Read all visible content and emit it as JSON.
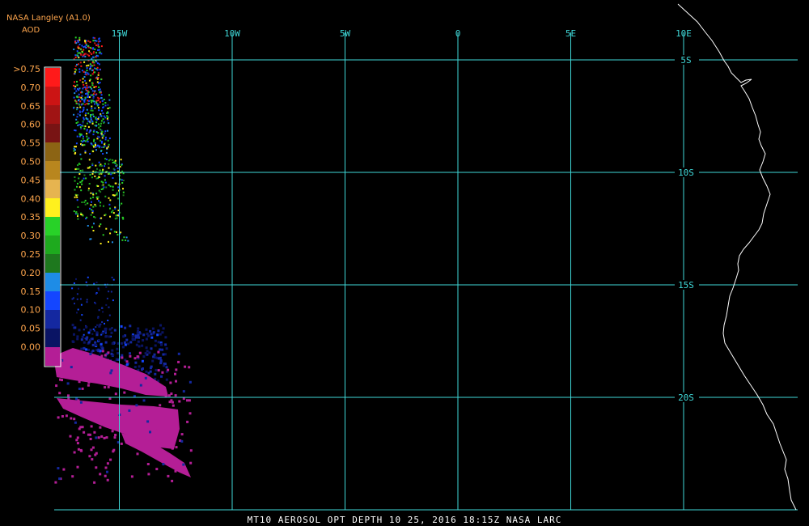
{
  "header": {
    "source": "NASA Langley (A1.0)",
    "product": "AOD"
  },
  "footer": {
    "caption": "MT10  AEROSOL OPT DEPTH   10 25, 2016 18:15Z   NASA LARC"
  },
  "colors": {
    "grid": "#3fd7d7",
    "coast": "#ffffff",
    "legend_text": "#ffa64d",
    "background": "#000000"
  },
  "legend": {
    "labels": [
      ">0.75",
      "0.70",
      "0.65",
      "0.60",
      "0.55",
      "0.50",
      "0.45",
      "0.40",
      "0.35",
      "0.30",
      "0.25",
      "0.20",
      "0.15",
      "0.10",
      "0.05",
      "0.00"
    ],
    "colors": [
      "#ff1a1a",
      "#cc1414",
      "#a01414",
      "#781414",
      "#8c6414",
      "#b8861e",
      "#e6b450",
      "#fff01e",
      "#28d228",
      "#1eaa1e",
      "#1e781e",
      "#1e8ce6",
      "#1446ff",
      "#1428a0",
      "#0a1464",
      "#b41e96"
    ]
  },
  "grid": {
    "longitudes": [
      {
        "label": "15W",
        "lon": -15
      },
      {
        "label": "10W",
        "lon": -10
      },
      {
        "label": "5W",
        "lon": -5
      },
      {
        "label": "0",
        "lon": 0
      },
      {
        "label": "5E",
        "lon": 5
      },
      {
        "label": "10E",
        "lon": 10
      }
    ],
    "latitudes": [
      {
        "label": "5S",
        "lat": -5
      },
      {
        "label": "10S",
        "lat": -10
      },
      {
        "label": "15S",
        "lat": -15
      },
      {
        "label": "20S",
        "lat": -20
      }
    ]
  }
}
